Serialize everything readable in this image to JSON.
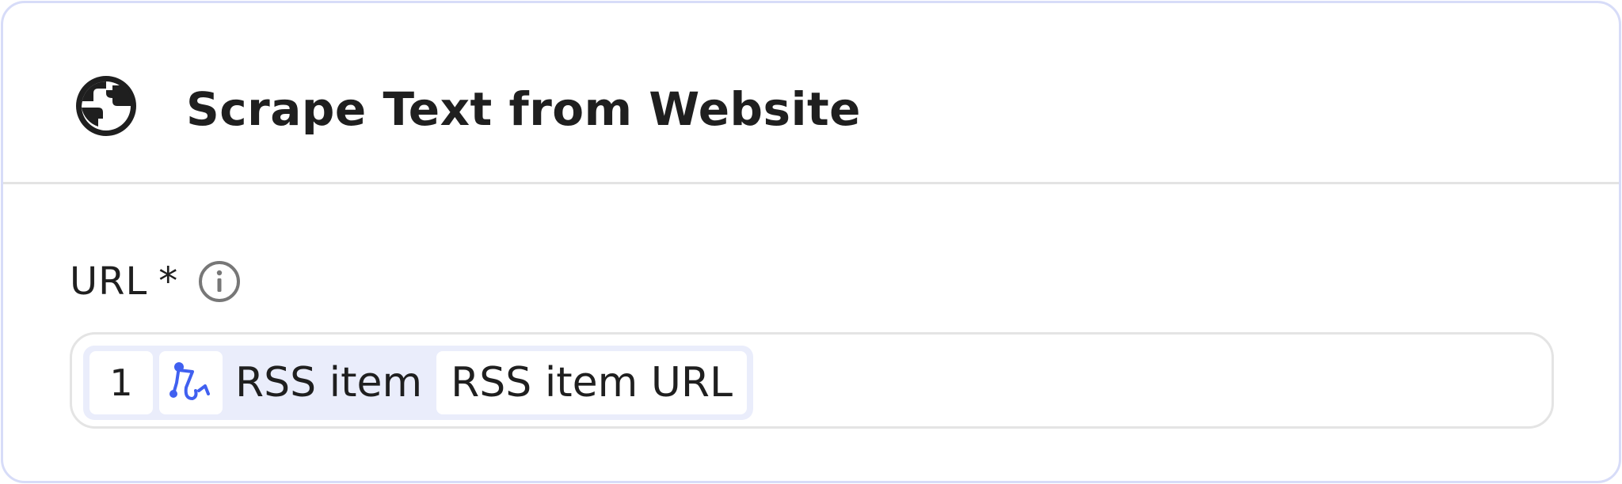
{
  "header": {
    "title": "Scrape Text from Website",
    "icon": "globe-icon"
  },
  "url_field": {
    "label": "URL",
    "required_mark": "*",
    "info_icon": "info-icon",
    "value": {
      "step_number": "1",
      "step_icon": "rss-branch-icon",
      "step_name": "RSS item",
      "field_name": "RSS item URL"
    }
  },
  "colors": {
    "card_border": "#d7dcf8",
    "pill_background": "#eaedfb",
    "accent_blue": "#4060f0",
    "text": "#1f1f1f"
  }
}
